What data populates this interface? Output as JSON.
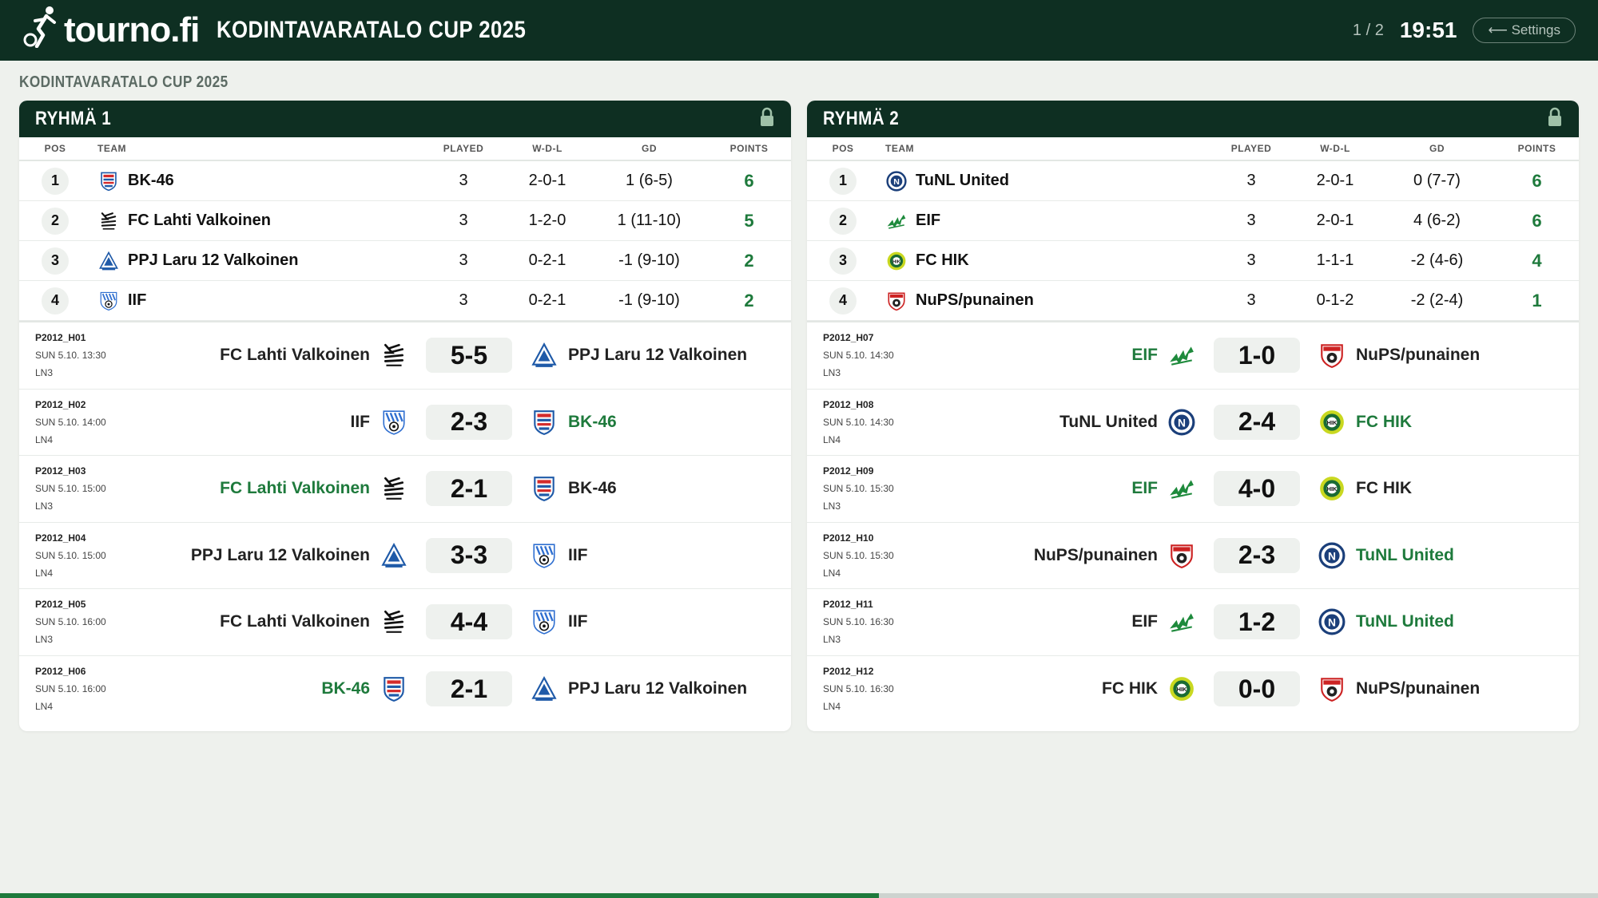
{
  "brand": {
    "logo_text": "tourno.fi",
    "cup_title": "KODINTAVARATALO CUP 2025"
  },
  "topbar": {
    "pager": "1 / 2",
    "clock": "19:51",
    "settings_label": "⟵ Settings",
    "progress": 0.55
  },
  "subtitle": "KODINTAVARATALO CUP 2025",
  "columns": {
    "pos": "POS",
    "team": "TEAM",
    "played": "PLAYED",
    "wdl": "W-D-L",
    "gd": "GD",
    "points": "POINTS"
  },
  "colors": {
    "dark_green": "#0e2f22",
    "accent_green": "#1e7a3c",
    "background": "#eef1ed"
  },
  "groups": [
    {
      "name": "RYHMÄ 1",
      "standings": [
        {
          "pos": "1",
          "team": "BK-46",
          "icon": "bk46-crest-icon",
          "played": "3",
          "wdl": "2-0-1",
          "gd": "1 (6-5)",
          "points": "6"
        },
        {
          "pos": "2",
          "team": "FC Lahti Valkoinen",
          "icon": "fc-lahti-crest-icon",
          "played": "3",
          "wdl": "1-2-0",
          "gd": "1 (11-10)",
          "points": "5"
        },
        {
          "pos": "3",
          "team": "PPJ Laru 12 Valkoinen",
          "icon": "ppj-crest-icon",
          "played": "3",
          "wdl": "0-2-1",
          "gd": "-1 (9-10)",
          "points": "2"
        },
        {
          "pos": "4",
          "team": "IIF",
          "icon": "iif-crest-icon",
          "played": "3",
          "wdl": "0-2-1",
          "gd": "-1 (9-10)",
          "points": "2"
        }
      ],
      "matches": [
        {
          "code": "P2012_H01",
          "time": "SUN 5.10. 13:30",
          "field": "LN3",
          "home": "FC Lahti Valkoinen",
          "home_icon": "fc-lahti-crest-icon",
          "score": "5-5",
          "away": "PPJ Laru 12 Valkoinen",
          "away_icon": "ppj-crest-icon",
          "winner": "none"
        },
        {
          "code": "P2012_H02",
          "time": "SUN 5.10. 14:00",
          "field": "LN4",
          "home": "IIF",
          "home_icon": "iif-crest-icon",
          "score": "2-3",
          "away": "BK-46",
          "away_icon": "bk46-crest-icon",
          "winner": "away"
        },
        {
          "code": "P2012_H03",
          "time": "SUN 5.10. 15:00",
          "field": "LN3",
          "home": "FC Lahti Valkoinen",
          "home_icon": "fc-lahti-crest-icon",
          "score": "2-1",
          "away": "BK-46",
          "away_icon": "bk46-crest-icon",
          "winner": "home"
        },
        {
          "code": "P2012_H04",
          "time": "SUN 5.10. 15:00",
          "field": "LN4",
          "home": "PPJ Laru 12 Valkoinen",
          "home_icon": "ppj-crest-icon",
          "score": "3-3",
          "away": "IIF",
          "away_icon": "iif-crest-icon",
          "winner": "none"
        },
        {
          "code": "P2012_H05",
          "time": "SUN 5.10. 16:00",
          "field": "LN3",
          "home": "FC Lahti Valkoinen",
          "home_icon": "fc-lahti-crest-icon",
          "score": "4-4",
          "away": "IIF",
          "away_icon": "iif-crest-icon",
          "winner": "none"
        },
        {
          "code": "P2012_H06",
          "time": "SUN 5.10. 16:00",
          "field": "LN4",
          "home": "BK-46",
          "home_icon": "bk46-crest-icon",
          "score": "2-1",
          "away": "PPJ Laru 12 Valkoinen",
          "away_icon": "ppj-crest-icon",
          "winner": "home"
        }
      ]
    },
    {
      "name": "RYHMÄ 2",
      "standings": [
        {
          "pos": "1",
          "team": "TuNL United",
          "icon": "tunl-crest-icon",
          "played": "3",
          "wdl": "2-0-1",
          "gd": "0 (7-7)",
          "points": "6"
        },
        {
          "pos": "2",
          "team": "EIF",
          "icon": "eif-crest-icon",
          "played": "3",
          "wdl": "2-0-1",
          "gd": "4 (6-2)",
          "points": "6"
        },
        {
          "pos": "3",
          "team": "FC HIK",
          "icon": "fchik-crest-icon",
          "played": "3",
          "wdl": "1-1-1",
          "gd": "-2 (4-6)",
          "points": "4"
        },
        {
          "pos": "4",
          "team": "NuPS/punainen",
          "icon": "nups-crest-icon",
          "played": "3",
          "wdl": "0-1-2",
          "gd": "-2 (2-4)",
          "points": "1"
        }
      ],
      "matches": [
        {
          "code": "P2012_H07",
          "time": "SUN 5.10. 14:30",
          "field": "LN3",
          "home": "EIF",
          "home_icon": "eif-crest-icon",
          "score": "1-0",
          "away": "NuPS/punainen",
          "away_icon": "nups-crest-icon",
          "winner": "home"
        },
        {
          "code": "P2012_H08",
          "time": "SUN 5.10. 14:30",
          "field": "LN4",
          "home": "TuNL United",
          "home_icon": "tunl-crest-icon",
          "score": "2-4",
          "away": "FC HIK",
          "away_icon": "fchik-crest-icon",
          "winner": "away"
        },
        {
          "code": "P2012_H09",
          "time": "SUN 5.10. 15:30",
          "field": "LN3",
          "home": "EIF",
          "home_icon": "eif-crest-icon",
          "score": "4-0",
          "away": "FC HIK",
          "away_icon": "fchik-crest-icon",
          "winner": "home"
        },
        {
          "code": "P2012_H10",
          "time": "SUN 5.10. 15:30",
          "field": "LN4",
          "home": "NuPS/punainen",
          "home_icon": "nups-crest-icon",
          "score": "2-3",
          "away": "TuNL United",
          "away_icon": "tunl-crest-icon",
          "winner": "away"
        },
        {
          "code": "P2012_H11",
          "time": "SUN 5.10. 16:30",
          "field": "LN3",
          "home": "EIF",
          "home_icon": "eif-crest-icon",
          "score": "1-2",
          "away": "TuNL United",
          "away_icon": "tunl-crest-icon",
          "winner": "away"
        },
        {
          "code": "P2012_H12",
          "time": "SUN 5.10. 16:30",
          "field": "LN4",
          "home": "FC HIK",
          "home_icon": "fchik-crest-icon",
          "score": "0-0",
          "away": "NuPS/punainen",
          "away_icon": "nups-crest-icon",
          "winner": "none"
        }
      ]
    }
  ]
}
